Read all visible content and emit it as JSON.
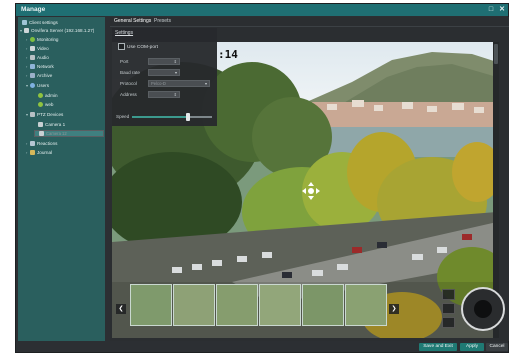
{
  "window": {
    "title": "Manage",
    "restore_glyph": "□",
    "close_glyph": "✕"
  },
  "tree": {
    "client_settings": "Client settings",
    "server": "Onvifera Server (192.168.1.27)",
    "monitoring": "Monitoring",
    "video": "Video",
    "audio": "Audio",
    "network": "Network",
    "archive": "Archive",
    "users": "Users",
    "admin": "admin",
    "web": "web",
    "ptz_devices": "PTZ Devices",
    "camera1": "Camera 1",
    "camera2": "Camera 12",
    "reactions": "Reactions",
    "journal": "Journal"
  },
  "tabs": [
    {
      "label": "General Settings"
    },
    {
      "label": "Presets"
    }
  ],
  "settings": {
    "header": "Settings",
    "use_com": "Use COM-port",
    "port_label": "Port",
    "baud_label": "Baud rate",
    "protocol_label": "Protocol",
    "protocol_value": "Pelco-D",
    "address_label": "Address",
    "speed_label": "Speed",
    "speed_fraction": 0.7
  },
  "video": {
    "clock": ":14"
  },
  "buttons": {
    "save_exit": "Save and Exit",
    "apply": "Apply",
    "cancel": "Cancel"
  },
  "icons": {
    "prev": "❮",
    "next": "❯",
    "move": "move-cursor"
  }
}
